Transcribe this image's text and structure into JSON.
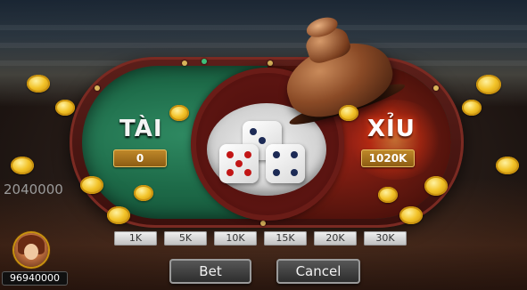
{
  "game": {
    "tai": {
      "title": "TÀI",
      "bet": "0"
    },
    "xiu": {
      "title": "XỈU",
      "bet": "1020K"
    },
    "side_amount": "2040000",
    "dice": [
      3,
      5,
      4
    ]
  },
  "chips": [
    "1K",
    "5K",
    "10K",
    "15K",
    "20K",
    "30K"
  ],
  "actions": {
    "bet": "Bet",
    "cancel": "Cancel"
  },
  "player": {
    "balance": "96940000"
  },
  "icons": {
    "cup": "dice-cup-icon",
    "coin": "gold-coin-icon",
    "avatar": "player-avatar"
  },
  "colors": {
    "tai_felt": "#1d6a48",
    "xiu_felt": "#a81c10",
    "bet_box": "#c18a2a",
    "coin": "#f2c227"
  }
}
